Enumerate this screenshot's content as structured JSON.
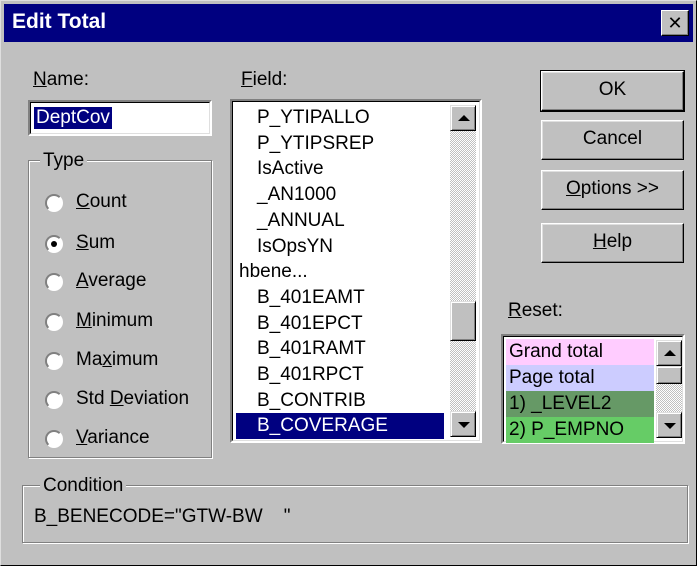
{
  "window": {
    "title": "Edit Total",
    "close_glyph": "✕"
  },
  "name": {
    "label_u": "N",
    "label_rest": "ame:",
    "value": "DeptCov"
  },
  "type_group": {
    "title": "Type",
    "options": [
      {
        "u": "C",
        "rest": "ount",
        "pre": "",
        "checked": false
      },
      {
        "u": "S",
        "rest": "um",
        "pre": "",
        "checked": true
      },
      {
        "u": "A",
        "rest": "verage",
        "pre": "",
        "checked": false
      },
      {
        "u": "M",
        "rest": "inimum",
        "pre": "",
        "checked": false
      },
      {
        "u": "x",
        "rest": "imum",
        "pre": "Ma",
        "checked": false
      },
      {
        "u": "D",
        "rest": "eviation",
        "pre": "Std ",
        "checked": false
      },
      {
        "u": "V",
        "rest": "ariance",
        "pre": "",
        "checked": false
      }
    ]
  },
  "field": {
    "label_u": "F",
    "label_rest": "ield:",
    "items": [
      {
        "text": "P_YTIPALLO",
        "indent": true
      },
      {
        "text": "P_YTIPSREP",
        "indent": true
      },
      {
        "text": "IsActive",
        "indent": true
      },
      {
        "text": "_AN1000",
        "indent": true
      },
      {
        "text": "_ANNUAL",
        "indent": true
      },
      {
        "text": "IsOpsYN",
        "indent": true
      },
      {
        "text": "hbene...",
        "indent": false
      },
      {
        "text": "B_401EAMT",
        "indent": true
      },
      {
        "text": "B_401EPCT",
        "indent": true
      },
      {
        "text": "B_401RAMT",
        "indent": true
      },
      {
        "text": "B_401RPCT",
        "indent": true
      },
      {
        "text": "B_CONTRIB",
        "indent": true
      },
      {
        "text": "B_COVERAGE",
        "indent": true,
        "selected": true
      }
    ]
  },
  "buttons": {
    "ok": "OK",
    "cancel": "Cancel",
    "options_u": "O",
    "options_rest": "ptions >>",
    "help_u": "H",
    "help_rest": "elp"
  },
  "reset": {
    "label_u": "R",
    "label_rest": "eset:",
    "items": [
      {
        "text": "Grand total",
        "bg": "#ffccff"
      },
      {
        "text": "Page total",
        "bg": "#ccccff"
      },
      {
        "text": "1) _LEVEL2",
        "bg": "#669966"
      },
      {
        "text": "2) P_EMPNO",
        "bg": "#66cc66"
      }
    ]
  },
  "condition": {
    "title": "Condition",
    "value": "B_BENECODE=\"GTW-BW    \""
  }
}
